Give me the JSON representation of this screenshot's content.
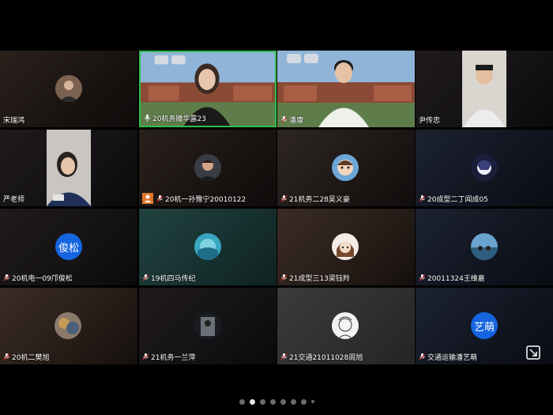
{
  "participants": [
    {
      "name": "宋瑞鸿",
      "mic": false,
      "type": "photo-avatar"
    },
    {
      "name": "20机务滕华露23",
      "mic": true,
      "type": "video"
    },
    {
      "name": "潘康",
      "mic": true,
      "type": "video"
    },
    {
      "name": "尹传忠",
      "mic": false,
      "type": "video"
    },
    {
      "name": "严老师",
      "mic": false,
      "type": "video"
    },
    {
      "name": "20机一孙豫宁20010122",
      "mic": true,
      "type": "photo-avatar",
      "host": true
    },
    {
      "name": "21机务二28吴义豪",
      "mic": true,
      "type": "photo-avatar"
    },
    {
      "name": "20成型二丁闻成05",
      "mic": true,
      "type": "photo-avatar"
    },
    {
      "name": "20机电一09邝俊松",
      "mic": true,
      "type": "text-avatar",
      "avatar_text": "俊松"
    },
    {
      "name": "19机四马传纪",
      "mic": true,
      "type": "photo-avatar"
    },
    {
      "name": "21成型三13梁钰羚",
      "mic": true,
      "type": "photo-avatar"
    },
    {
      "name": "20011324王维嘉",
      "mic": true,
      "type": "photo-avatar"
    },
    {
      "name": "20机二樊旭",
      "mic": true,
      "type": "photo-avatar"
    },
    {
      "name": "21机务一兰萍",
      "mic": true,
      "type": "photo-avatar"
    },
    {
      "name": "21交通21011028周旭",
      "mic": true,
      "type": "photo-avatar"
    },
    {
      "name": "交通运输潘艺萌",
      "mic": true,
      "type": "text-avatar",
      "avatar_text": "艺萌"
    }
  ],
  "pagination": {
    "total": 8,
    "current": 2
  },
  "colors": {
    "active_speaker_border": "#2fbf4a",
    "text_avatar": "#1565e0",
    "host_badge": "#e0742a"
  }
}
